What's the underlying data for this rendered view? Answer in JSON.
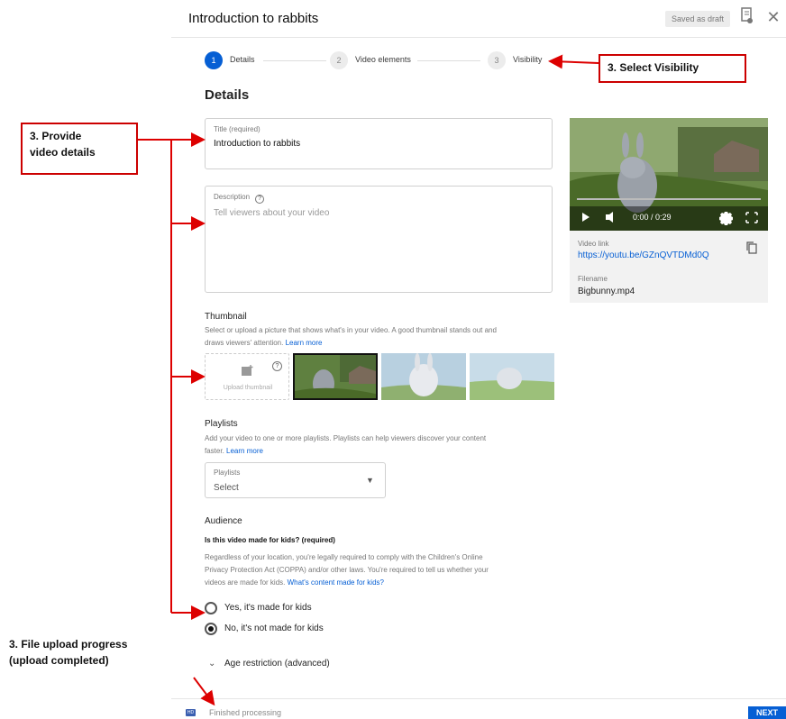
{
  "header": {
    "title": "Introduction to rabbits",
    "saved_label": "Saved as draft",
    "icons": [
      "report-icon",
      "close-icon"
    ]
  },
  "steps": [
    {
      "number": "1",
      "label": "Details",
      "active": true
    },
    {
      "number": "2",
      "label": "Video elements",
      "active": false
    },
    {
      "number": "3",
      "label": "Visibility",
      "active": false
    }
  ],
  "details": {
    "heading": "Details",
    "title_label": "Title (required)",
    "title_value": "Introduction to rabbits",
    "description_label": "Description",
    "description_placeholder": "Tell viewers about your video"
  },
  "preview": {
    "time": "0:00 / 0:29",
    "video_link_label": "Video link",
    "video_link": "https://youtu.be/GZnQVTDMd0Q",
    "filename_label": "Filename",
    "filename": "Bigbunny.mp4"
  },
  "thumbnail": {
    "title": "Thumbnail",
    "desc_line1": "Select or upload a picture that shows what's in your video. A good thumbnail stands out and",
    "desc_line2": "draws viewers' attention.",
    "learn_more": "Learn more",
    "upload_label": "Upload thumbnail"
  },
  "playlists": {
    "title": "Playlists",
    "desc_line1": "Add your video to one or more playlists. Playlists can help viewers discover your content",
    "desc_line2": "faster.",
    "learn_more": "Learn more",
    "select_label": "Playlists",
    "select_value": "Select"
  },
  "audience": {
    "title": "Audience",
    "question": "Is this video made for kids? (required)",
    "desc_line1": "Regardless of your location, you're legally required to comply with the Children's Online",
    "desc_line2": "Privacy Protection Act (COPPA) and/or other laws. You're required to tell us whether your",
    "desc_line3": "videos are made for kids.",
    "desc_link": "What's content made for kids?",
    "option_yes": "Yes, it's made for kids",
    "option_no": "No, it's not made for kids",
    "selected": "no",
    "age_restriction": "Age restriction (advanced)"
  },
  "footer": {
    "hd_badge": "HD",
    "status": "Finished processing",
    "next_label": "NEXT"
  },
  "annotations": {
    "visibility": "3. Select Visibility",
    "details_line1": "3. Provide",
    "details_line2": "video details",
    "upload_line1": "3. File upload progress",
    "upload_line2": "(upload completed)",
    "accent_color": "#cc0000"
  }
}
